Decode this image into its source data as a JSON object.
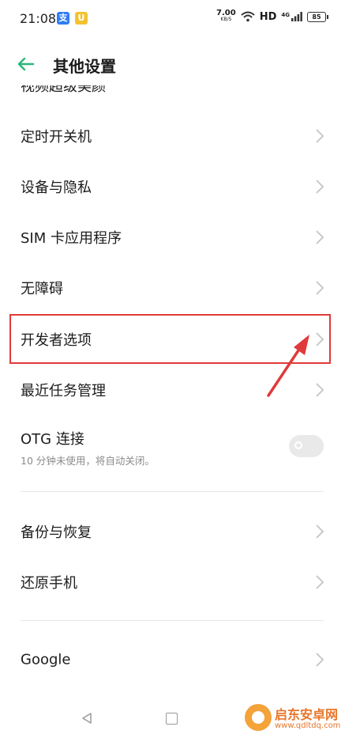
{
  "status_bar": {
    "time": "21:08",
    "badges": [
      "支",
      "U"
    ],
    "net_speed": "7.00",
    "net_unit": "KB/S",
    "hd": "HD",
    "signal": "4G",
    "battery": "85"
  },
  "header": {
    "title": "其他设置"
  },
  "clipped_item": {
    "label": "视频超级美颜"
  },
  "menu_items": [
    {
      "label": "定时开关机"
    },
    {
      "label": "设备与隐私"
    },
    {
      "label": "SIM 卡应用程序"
    },
    {
      "label": "无障碍"
    },
    {
      "label": "开发者选项"
    },
    {
      "label": "最近任务管理"
    }
  ],
  "otg": {
    "label": "OTG 连接",
    "description": "10 分钟未使用，将自动关闭。",
    "enabled": false
  },
  "menu_items_2": [
    {
      "label": "备份与恢复"
    },
    {
      "label": "还原手机"
    }
  ],
  "menu_items_3": [
    {
      "label": "Google"
    }
  ],
  "watermark": {
    "name": "启东安卓网",
    "url": "www.qdltdq.com"
  },
  "colors": {
    "accent": "#2bb57a",
    "highlight": "#e03a3a"
  }
}
